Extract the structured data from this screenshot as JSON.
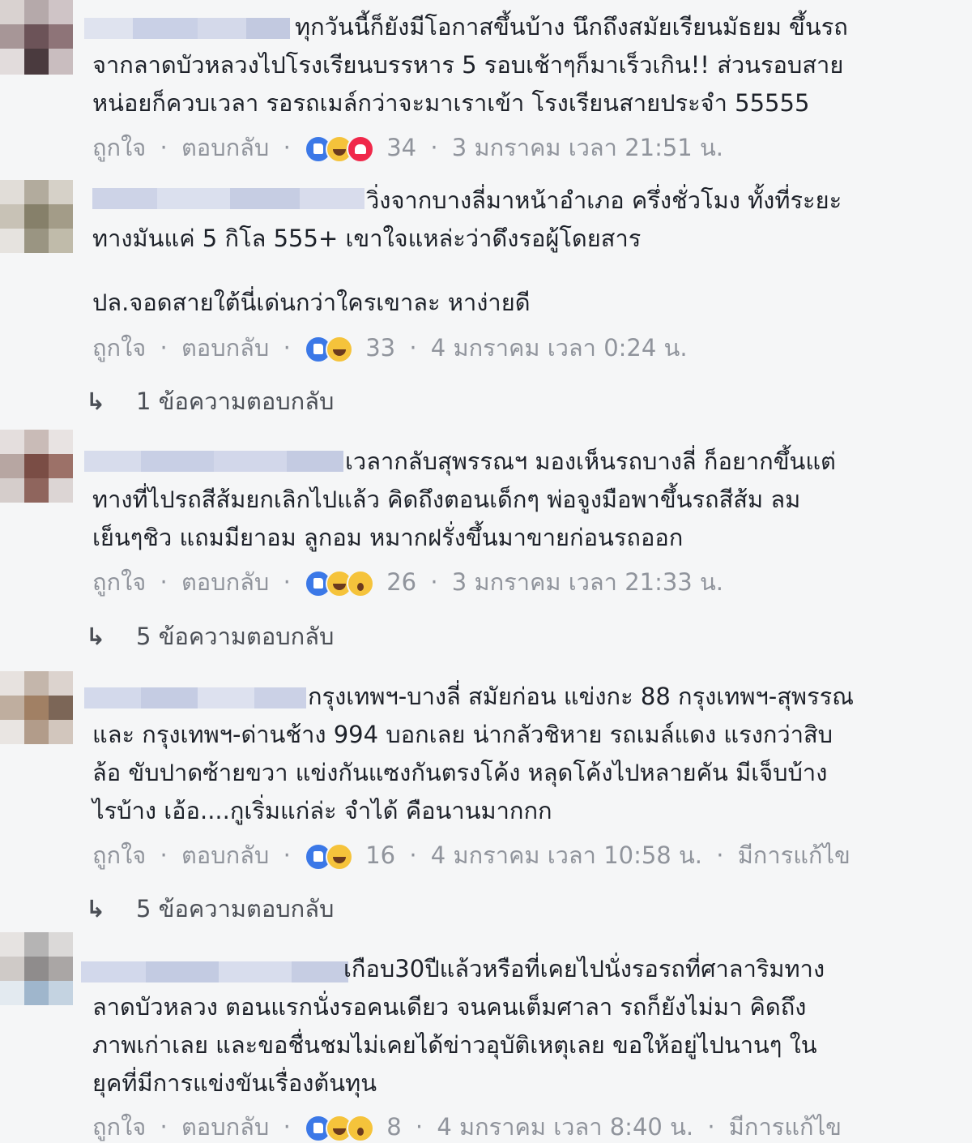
{
  "labels": {
    "like": "ถูกใจ",
    "reply": "ตอบกลับ",
    "edited": "มีการแก้ไข",
    "dot": "·"
  },
  "icons": {
    "reply_arrow": "reply-arrow-icon"
  },
  "colors": {
    "background": "#f5f6f7",
    "text": "#1d2129",
    "meta": "#90949c",
    "like_blue": "#3b78e7",
    "haha_yellow": "#f5c33b",
    "love_red": "#f0284a"
  },
  "comments": [
    {
      "lines": [
        "ทุกวันนี้ก็ยังมีโอกาสขึ้นบ้าง นึกถึงสมัยเรียนมัธยม ขึ้นรถ",
        "จากลาดบัวหลวงไปโรงเรียนบรรหาร 5 รอบเช้าๆก็มาเร็วเกิน!! ส่วนรอบสาย",
        "หน่อยก็ควบเวลา รอรถเมล์กว่าจะมาเราเข้า โรงเรียนสายประจำ 55555"
      ],
      "reactions": [
        "like",
        "haha",
        "love"
      ],
      "count": "34",
      "time": "3 มกราคม เวลา 21:51 น."
    },
    {
      "lines": [
        "วิ่งจากบางลี่มาหน้าอำเภอ ครึ่งชั่วโมง ทั้งที่ระยะ",
        "ทางมันแค่ 5 กิโล 555+ เขาใจแหล่ะว่าดึงรอผู้โดยสาร"
      ],
      "extra_line": "ปล.จอดสายใต้นี่เด่นกว่าใครเขาละ หาง่ายดี",
      "reactions": [
        "like",
        "haha"
      ],
      "count": "33",
      "time": "4 มกราคม เวลา 0:24 น.",
      "replies": "1 ข้อความตอบกลับ"
    },
    {
      "lines": [
        "เวลากลับสุพรรณฯ มองเห็นรถบางลี่ ก็อยากขึ้นแต่",
        "ทางที่ไปรถสีส้มยกเลิกไปแล้ว คิดถึงตอนเด็กๆ พ่อจูงมือพาขึ้นรถสีส้ม ลม",
        "เย็นๆชิว แถมมียาอม ลูกอม หมากฝรั่งขึ้นมาขายก่อนรถออก"
      ],
      "reactions": [
        "like",
        "haha",
        "wow"
      ],
      "count": "26",
      "time": "3 มกราคม เวลา 21:33 น.",
      "replies": "5 ข้อความตอบกลับ"
    },
    {
      "lines": [
        "กรุงเทพฯ-บางลี่ สมัยก่อน แข่งกะ 88 กรุงเทพฯ-สุพรรณ",
        "และ กรุงเทพฯ-ด่านช้าง 994 บอกเลย น่ากลัวชิหาย รถเมล์แดง แรงกว่าสิบ",
        "ล้อ ขับปาดซ้ายขวา แข่งกันแซงกันตรงโค้ง หลุดโค้งไปหลายคัน มีเจ็บบ้าง",
        "ไรบ้าง เอ้อ....กูเริ่มแก่ล่ะ จำได้ คือนานมากกก"
      ],
      "reactions": [
        "like",
        "haha"
      ],
      "count": "16",
      "time": "4 มกราคม เวลา 10:58 น.",
      "edited": true,
      "replies": "5 ข้อความตอบกลับ"
    },
    {
      "lines": [
        "เกือบ30ปีแล้วหรือที่เคยไปนั่งรอรถที่ศาลาริมทาง",
        "ลาดบัวหลวง ตอนแรกนั่งรอคนเดียว จนคนเต็มศาลา รถก็ยังไม่มา คิดถึง",
        "ภาพเก่าเลย และขอชื่นชมไม่เคยได้ข่าวอุบัติเหตุเลย ขอให้อยู่ไปนานๆ ใน",
        "ยุคที่มีการแข่งขันเรื่องต้นทุน"
      ],
      "reactions": [
        "like",
        "haha",
        "wow"
      ],
      "count": "8",
      "time": "4 มกราคม เวลา 8:40 น.",
      "edited": true
    }
  ]
}
